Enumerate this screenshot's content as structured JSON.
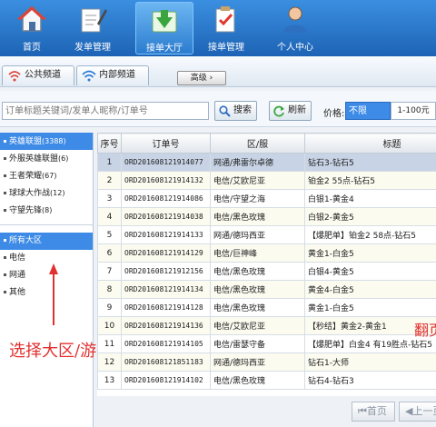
{
  "nav": {
    "items": [
      {
        "label": "首页",
        "icon": "home-icon"
      },
      {
        "label": "发单管理",
        "icon": "edit-doc-icon"
      },
      {
        "label": "接单大厅",
        "icon": "download-icon"
      },
      {
        "label": "接单管理",
        "icon": "clipboard-check-icon"
      },
      {
        "label": "个人中心",
        "icon": "user-icon"
      }
    ],
    "active": "接单大厅"
  },
  "channels": {
    "public_label": "公共频道",
    "internal_label": "内部频道",
    "advanced_label": "高级 ›"
  },
  "search": {
    "placeholder": "订单标题关键词/发单人昵称/订单号",
    "search_label": "搜索",
    "refresh_label": "刷新",
    "price_label": "价格:",
    "price_selected": "不限",
    "price_option": "1-100元"
  },
  "sidebar": {
    "games": [
      {
        "label": "英雄联盟",
        "count": "(3388)",
        "selected": true
      },
      {
        "label": "外服英雄联盟",
        "count": "(6)"
      },
      {
        "label": "王者荣耀",
        "count": "(67)"
      },
      {
        "label": "球球大作战",
        "count": "(12)"
      },
      {
        "label": "守望先锋",
        "count": "(8)"
      }
    ],
    "regions": [
      {
        "label": "所有大区",
        "selected": true
      },
      {
        "label": "电信"
      },
      {
        "label": "网通"
      },
      {
        "label": "其他"
      }
    ]
  },
  "annotation": "选择大区/游戏",
  "annotation_right": "翻页",
  "table": {
    "headers": [
      "序号",
      "订单号",
      "区/服",
      "标题"
    ],
    "rows": [
      [
        "1",
        "ORD2016081219140​77",
        "网通/弗雷尔卓德",
        "钻石3-钻石5"
      ],
      [
        "2",
        "ORD201608121914132",
        "电信/艾欧尼亚",
        "铂金2  55点-钻石5"
      ],
      [
        "3",
        "ORD201608121914086",
        "电信/守望之海",
        "白银1-黄金4"
      ],
      [
        "4",
        "ORD201608121914038",
        "电信/黑色玫瑰",
        "白银2-黄金5"
      ],
      [
        "5",
        "ORD201608121914133",
        "网通/德玛西亚",
        "【爆肥单】铂金2  58点-钻石5"
      ],
      [
        "6",
        "ORD201608121914129",
        "电信/巨神峰",
        "黄金1-白金5"
      ],
      [
        "7",
        "ORD201608121912156",
        "电信/黑色玫瑰",
        "白银4-黄金5"
      ],
      [
        "8",
        "ORD201608121914134",
        "电信/黑色玫瑰",
        "黄金4-白金5"
      ],
      [
        "9",
        "ORD201608121914128",
        "电信/黑色玫瑰",
        "黄金1-白金5"
      ],
      [
        "10",
        "ORD201608121914136",
        "电信/艾欧尼亚",
        "【秒结】黄金2-黄金1"
      ],
      [
        "11",
        "ORD201608121914105",
        "电信/雷瑟守备",
        "【爆肥单】白金4 有19胜点-钻石5"
      ],
      [
        "12",
        "ORD201608121851183",
        "网通/德玛西亚",
        "钻石1-大师"
      ],
      [
        "13",
        "ORD201608121914102",
        "电信/黑色玫瑰",
        "钻石4-钻石3"
      ]
    ]
  },
  "pager": {
    "first_label": "首页",
    "prev_label": "上一页"
  }
}
